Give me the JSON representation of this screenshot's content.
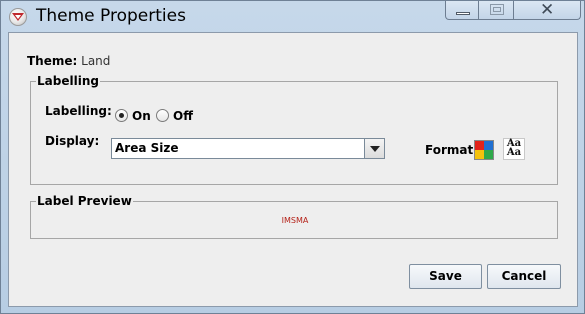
{
  "window": {
    "title": "Theme Properties",
    "app_icon": "imsma-icon",
    "controls": [
      "minimize-icon",
      "maximize-icon",
      "close-icon"
    ],
    "close_glyph": "✕"
  },
  "theme": {
    "label": "Theme:",
    "value": "Land"
  },
  "labelling": {
    "group_title": "Labelling",
    "labelling_label": "Labelling:",
    "options": [
      {
        "label": "On",
        "selected": true
      },
      {
        "label": "Off",
        "selected": false
      }
    ],
    "display_label": "Display:",
    "display_value": "Area Size",
    "format_label": "Format:",
    "font_icon_text_1": "Aa",
    "font_icon_text_2": "Aa",
    "color_icon_colors": [
      "#e2231a",
      "#1f6fd1",
      "#f4c20d",
      "#2ea84a"
    ]
  },
  "preview": {
    "group_title": "Label Preview",
    "text": "IMSMA"
  },
  "buttons": {
    "save": "Save",
    "cancel": "Cancel"
  },
  "colors": {
    "window_frame": "#c6d8ea",
    "client_bg": "#eeeeee",
    "preview_text": "#b5231a"
  }
}
